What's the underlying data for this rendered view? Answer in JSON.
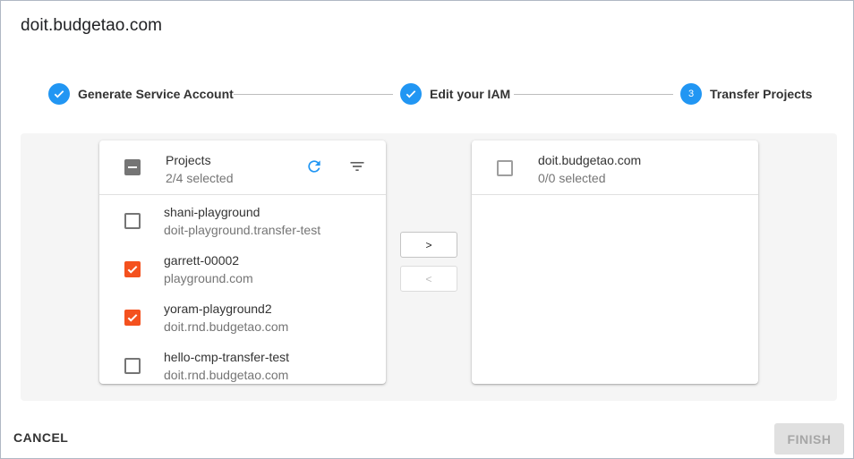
{
  "dialog": {
    "title": "doit.budgetao.com"
  },
  "stepper": {
    "steps": [
      {
        "label": "Generate Service Account",
        "state": "completed",
        "icon": "check-icon"
      },
      {
        "label": "Edit your IAM",
        "state": "completed",
        "icon": "check-icon"
      },
      {
        "label": "Transfer Projects",
        "state": "active",
        "number": "3"
      }
    ],
    "accent_color": "#2196f3"
  },
  "left_list": {
    "title": "Projects",
    "selection": "2/4 selected",
    "header_checkbox_state": "indeterminate",
    "icons": [
      "refresh-icon",
      "filter-icon"
    ],
    "items": [
      {
        "title": "shani-playground",
        "subtitle": "doit-playground.transfer-test",
        "checked": false
      },
      {
        "title": "garrett-00002",
        "subtitle": "playground.com",
        "checked": true
      },
      {
        "title": "yoram-playground2",
        "subtitle": "doit.rnd.budgetao.com",
        "checked": true
      },
      {
        "title": "hello-cmp-transfer-test",
        "subtitle": "doit.rnd.budgetao.com",
        "checked": false
      }
    ]
  },
  "right_list": {
    "title": "doit.budgetao.com",
    "selection": "0/0 selected",
    "header_checkbox_state": "unchecked",
    "items": []
  },
  "transfer_buttons": {
    "move_right": ">",
    "move_left": "<"
  },
  "actions": {
    "cancel": "CANCEL",
    "finish": "FINISH"
  },
  "colors": {
    "checkbox_checked": "#f4511e",
    "refresh_icon": "#2196f3",
    "finish_disabled_bg": "#e0e0e0"
  }
}
